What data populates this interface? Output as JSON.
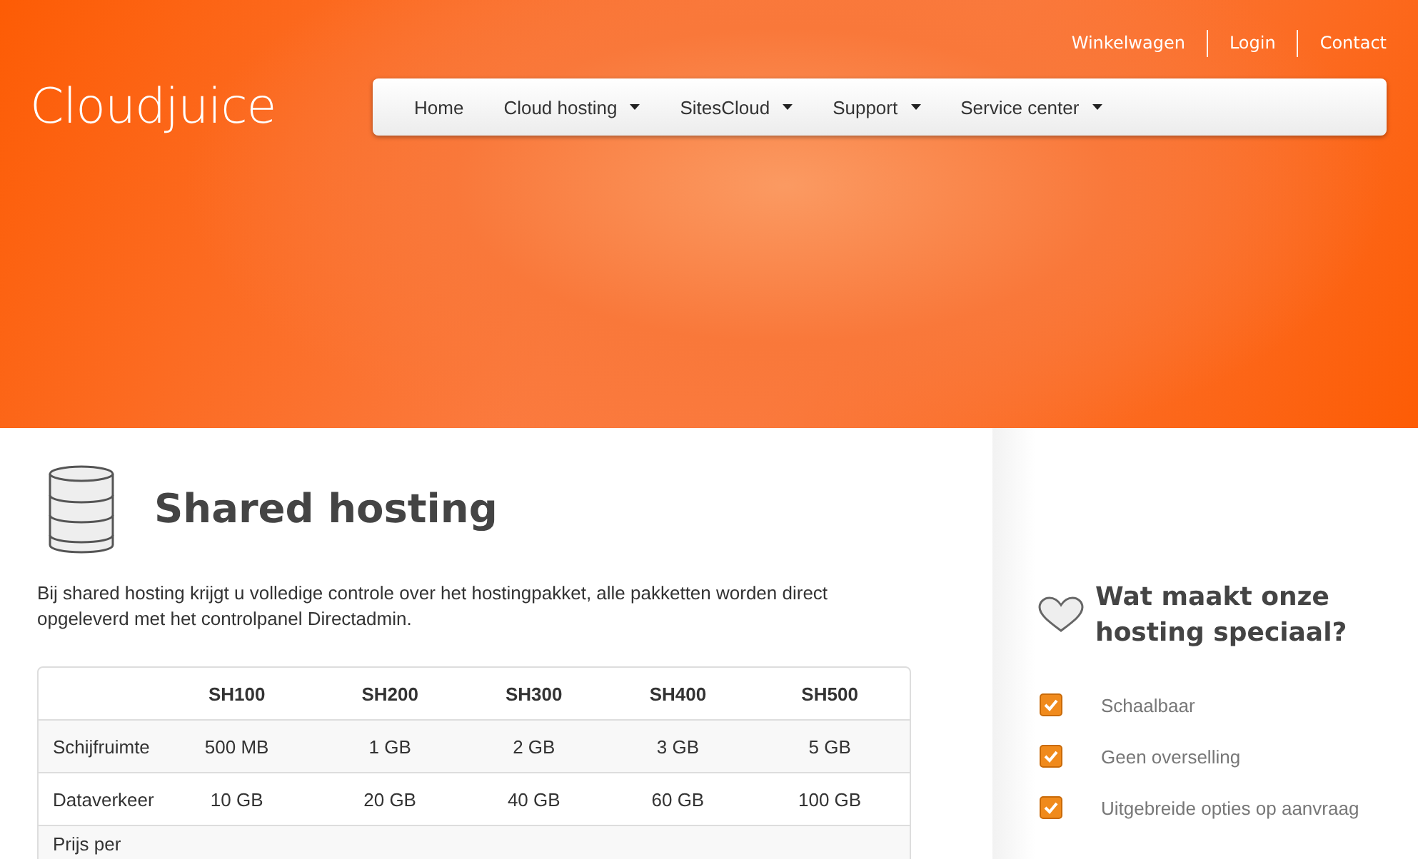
{
  "brand": {
    "logo_bold": "Cloud",
    "logo_light": "juice"
  },
  "top_links": [
    "Winkelwagen",
    "Login",
    "Contact"
  ],
  "nav": [
    {
      "label": "Home",
      "dropdown": false
    },
    {
      "label": "Cloud hosting",
      "dropdown": true
    },
    {
      "label": "SitesCloud",
      "dropdown": true
    },
    {
      "label": "Support",
      "dropdown": true
    },
    {
      "label": "Service center",
      "dropdown": true
    }
  ],
  "page": {
    "title": "Shared hosting",
    "intro": "Bij shared hosting krijgt u volledige controle over het hostingpakket, alle pakketten worden direct opgeleverd met het controlpanel Directadmin."
  },
  "table": {
    "columns": [
      "SH100",
      "SH200",
      "SH300",
      "SH400",
      "SH500"
    ],
    "rows": [
      {
        "label": "Schijfruimte",
        "cells": [
          "500 MB",
          "1 GB",
          "2 GB",
          "3 GB",
          "5 GB"
        ]
      },
      {
        "label": "Dataverkeer",
        "cells": [
          "10 GB",
          "20 GB",
          "40 GB",
          "60 GB",
          "100 GB"
        ]
      },
      {
        "label": "Prijs per",
        "cells": []
      }
    ]
  },
  "sidebar": {
    "title": "Wat maakt onze hosting speciaal?",
    "features": [
      "Schaalbaar",
      "Geen overselling",
      "Uitgebreide opties op aanvraag"
    ]
  }
}
